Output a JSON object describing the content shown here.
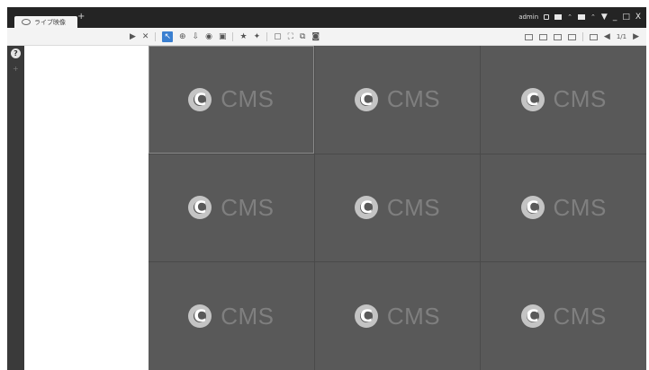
{
  "titlebar": {
    "tab_label": "ライブ映像",
    "add_tab": "+",
    "user": "admin",
    "buttons": {
      "pin": "▼",
      "minimize": "_",
      "restore": "□",
      "close": "X"
    }
  },
  "toolbar": {
    "left_icons": [
      "play-icon",
      "stop-icon",
      "pointer-icon",
      "zoom-icon",
      "download-icon",
      "eye-icon",
      "image-icon",
      "star-icon",
      "favorite-icon",
      "layout-icon",
      "fullscreen-icon",
      "window-icon",
      "camera-icon"
    ],
    "right_label": "1/1"
  },
  "sidepanel": {
    "help": "?",
    "add": "+"
  },
  "grid": {
    "rows": 3,
    "cols": 3,
    "cells": [
      {
        "text": "CMS"
      },
      {
        "text": "CMS"
      },
      {
        "text": "CMS"
      },
      {
        "text": "CMS"
      },
      {
        "text": "CMS"
      },
      {
        "text": "CMS"
      },
      {
        "text": "CMS"
      },
      {
        "text": "CMS"
      },
      {
        "text": "CMS"
      }
    ]
  },
  "colors": {
    "accent": "#3a7fd0",
    "grid_bg": "#595959",
    "cms_text": "#7f7f7f"
  }
}
